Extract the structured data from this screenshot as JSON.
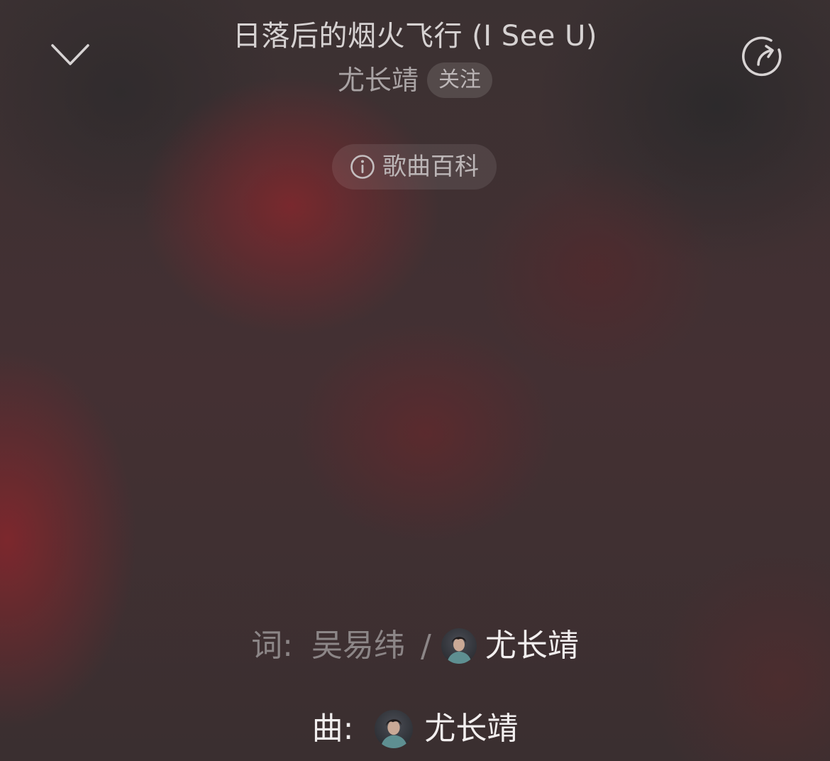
{
  "header": {
    "collapse_icon": "chevron-down-icon",
    "share_icon": "share-icon",
    "song_title": "日落后的烟火飞行 (I See U)",
    "artist": "尤长靖",
    "follow_label": "关注"
  },
  "wiki": {
    "icon": "info-icon",
    "label": "歌曲百科"
  },
  "credits": {
    "lyricist_label": "词:",
    "lyricist_primary": "吴易纬",
    "separator": "/",
    "lyricist_secondary": "尤长靖",
    "composer_label": "曲:",
    "composer": "尤长靖"
  },
  "colors": {
    "background": "#3d2e30",
    "accent_red": "#8c262c",
    "text_primary": "#f2efef",
    "text_secondary": "#a9a3a4"
  }
}
